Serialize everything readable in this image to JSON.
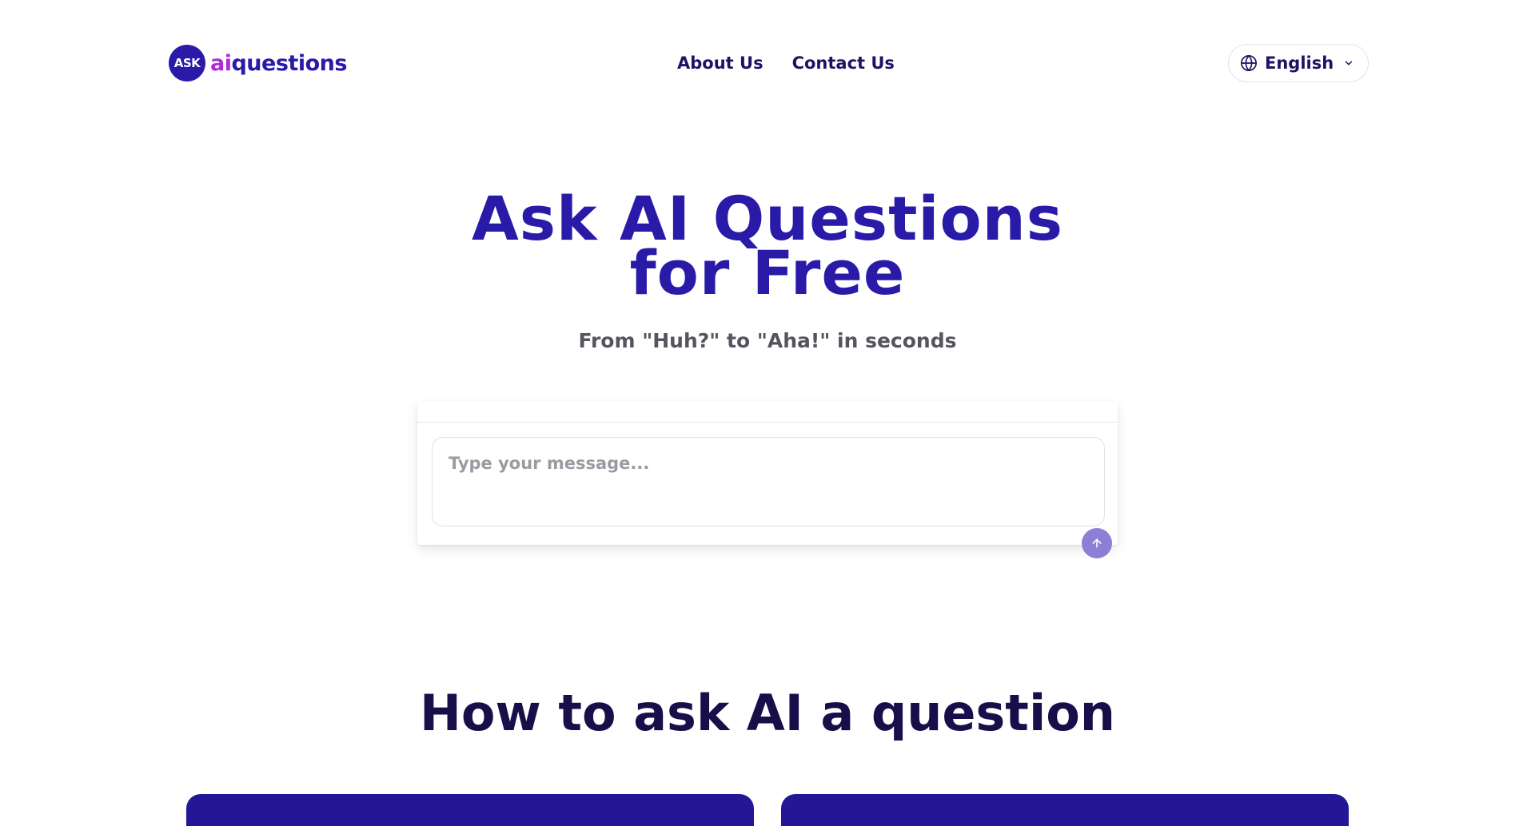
{
  "header": {
    "logo": {
      "badge": "ASK",
      "ai": "ai",
      "rest": "questions"
    },
    "nav": [
      {
        "label": "About Us"
      },
      {
        "label": "Contact Us"
      }
    ],
    "language": {
      "label": "English",
      "icon": "globe-icon"
    }
  },
  "hero": {
    "title_line1": "Ask AI Questions",
    "title_line2": "for Free",
    "subtitle": "From \"Huh?\" to \"Aha!\" in seconds"
  },
  "chat": {
    "placeholder": "Type your message...",
    "send_icon": "arrow-up-icon"
  },
  "how_to": {
    "title": "How to ask AI a question"
  },
  "colors": {
    "brand": "#2a1aa8",
    "accent": "#b02bd8",
    "send": "#8d7fd6",
    "dark": "#160f4a"
  }
}
